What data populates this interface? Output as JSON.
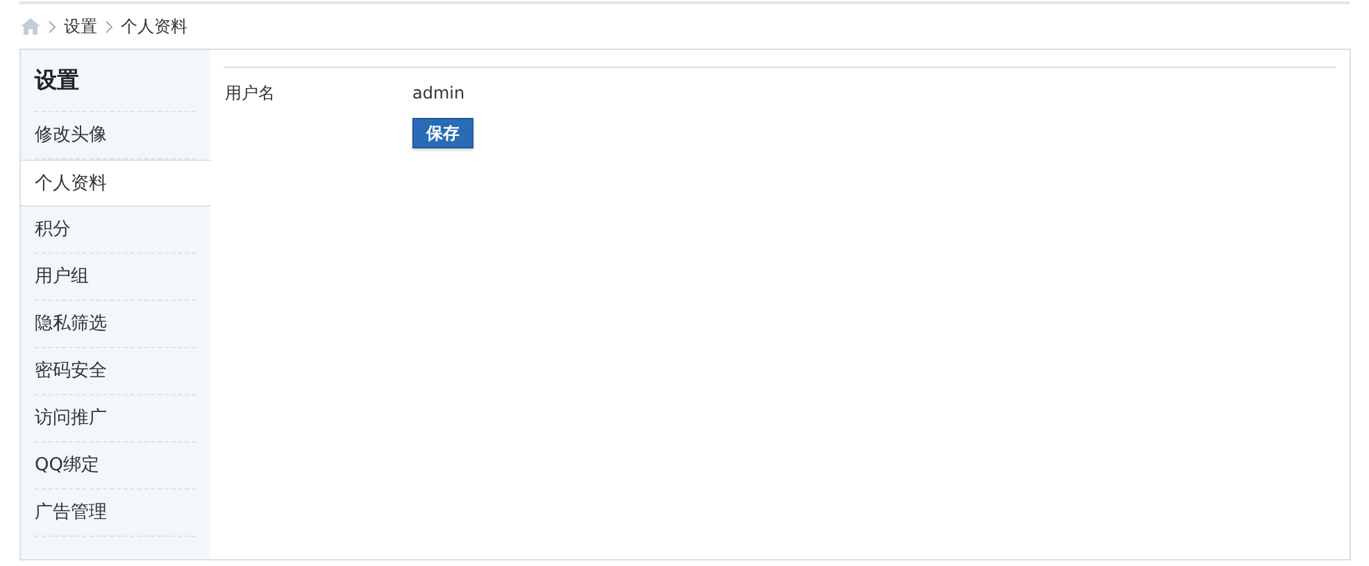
{
  "breadcrumb": {
    "items": [
      "设置",
      "个人资料"
    ]
  },
  "sidebar": {
    "title": "设置",
    "items": [
      {
        "label": "修改头像",
        "selected": false
      },
      {
        "label": "个人资料",
        "selected": true
      },
      {
        "label": "积分",
        "selected": false
      },
      {
        "label": "用户组",
        "selected": false
      },
      {
        "label": "隐私筛选",
        "selected": false
      },
      {
        "label": "密码安全",
        "selected": false
      },
      {
        "label": "访问推广",
        "selected": false
      },
      {
        "label": "QQ绑定",
        "selected": false
      },
      {
        "label": "广告管理",
        "selected": false
      }
    ]
  },
  "form": {
    "fields": [
      {
        "label": "用户名",
        "value": "admin"
      }
    ],
    "submit": "保存"
  }
}
